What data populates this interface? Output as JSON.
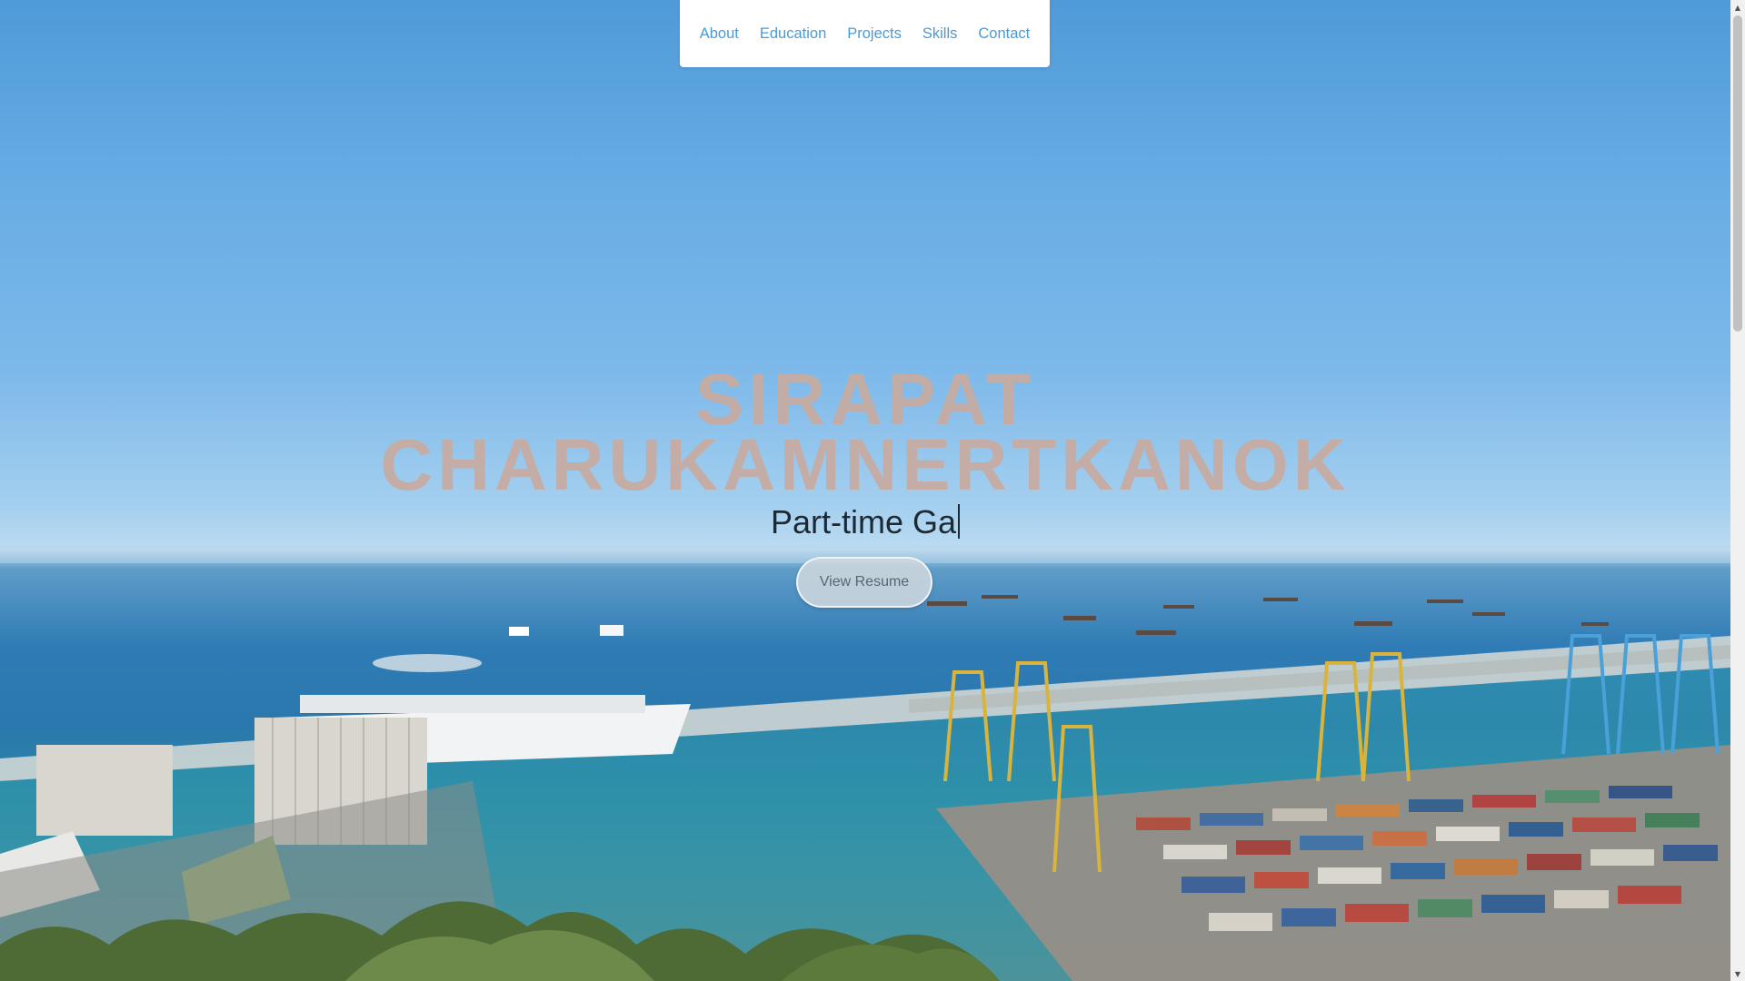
{
  "nav": {
    "items": [
      {
        "label": "About"
      },
      {
        "label": "Education"
      },
      {
        "label": "Projects"
      },
      {
        "label": "Skills"
      },
      {
        "label": "Contact"
      }
    ]
  },
  "hero": {
    "title_line1": "SIRAPAT",
    "title_line2": "CHARUKAMNERTKANOK",
    "typed_subtitle": "Part-time Ga",
    "resume_button": "View Resume"
  },
  "colors": {
    "nav_link": "#4a9ad6",
    "title": "#c8aaa0",
    "subtitle": "#1c2a36",
    "button_bg": "#cdd7de"
  },
  "icons": {
    "scroll_up": "triangle-up-icon",
    "scroll_down": "triangle-down-icon"
  }
}
